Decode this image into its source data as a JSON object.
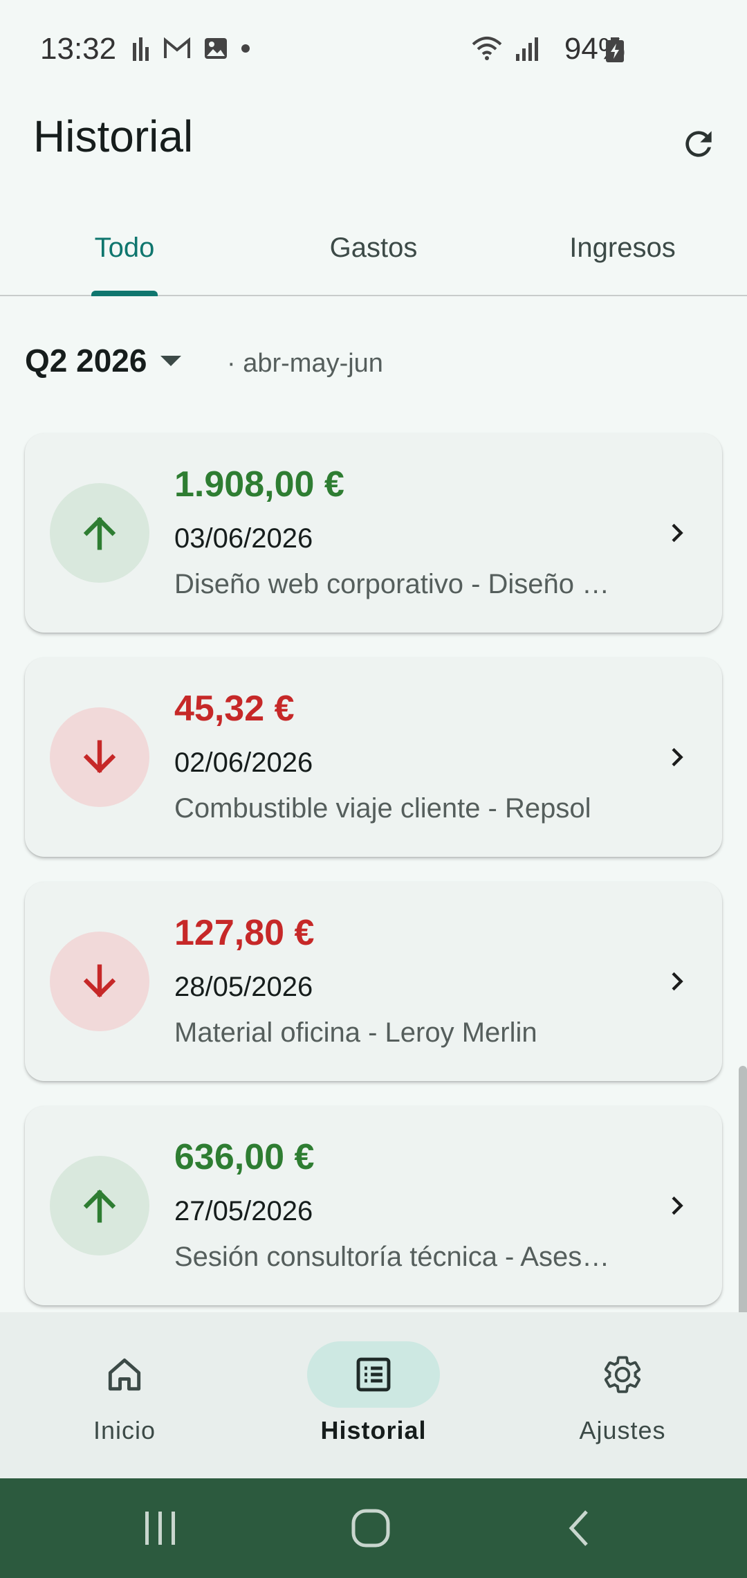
{
  "status_bar": {
    "time": "13:32",
    "battery": "94%",
    "left_icons": [
      "signal-bars-icon",
      "gmail-icon",
      "gallery-icon",
      "dot-icon"
    ],
    "right_icons": [
      "wifi-icon",
      "cell-signal-icon",
      "battery-charging-icon"
    ]
  },
  "app_bar": {
    "title": "Historial",
    "action_icon": "refresh-icon"
  },
  "tabs": [
    {
      "label": "Todo",
      "active": true
    },
    {
      "label": "Gastos",
      "active": false
    },
    {
      "label": "Ingresos",
      "active": false
    }
  ],
  "period": {
    "label": "Q2 2026",
    "subtitle": "· abr-may-jun"
  },
  "transactions": [
    {
      "type": "income",
      "amount": "1.908,00 €",
      "date": "03/06/2026",
      "description": "Diseño web corporativo - Diseño …"
    },
    {
      "type": "expense",
      "amount": "45,32 €",
      "date": "02/06/2026",
      "description": "Combustible viaje cliente - Repsol"
    },
    {
      "type": "expense",
      "amount": "127,80 €",
      "date": "28/05/2026",
      "description": "Material oficina - Leroy Merlin"
    },
    {
      "type": "income",
      "amount": "636,00 €",
      "date": "27/05/2026",
      "description": "Sesión consultoría técnica - Ases…"
    }
  ],
  "bottom_nav": [
    {
      "label": "Inicio",
      "icon": "home-icon",
      "active": false
    },
    {
      "label": "Historial",
      "icon": "list-icon",
      "active": true
    },
    {
      "label": "Ajustes",
      "icon": "settings-icon",
      "active": false
    }
  ],
  "colors": {
    "primary": "#0F766E",
    "income": "#2E7D32",
    "expense": "#C62828",
    "system_nav": "#2C5A3E"
  }
}
